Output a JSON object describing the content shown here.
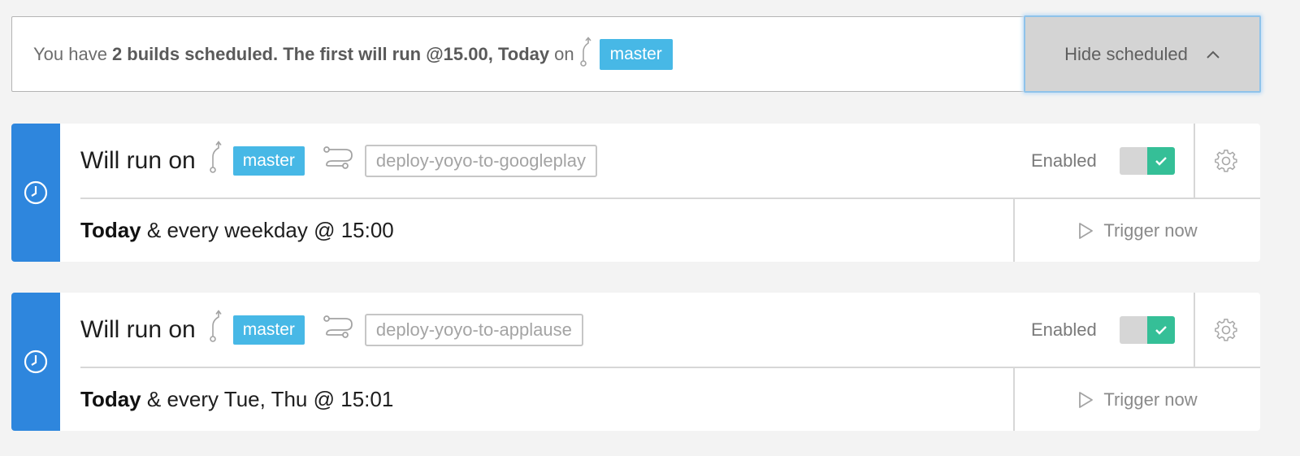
{
  "banner": {
    "prefix": "You have",
    "count_text": "2 builds scheduled. The first will run @15.00, Today",
    "suffix": "on",
    "branch": "master",
    "hide_button_label": "Hide scheduled"
  },
  "schedules": [
    {
      "will_run_label": "Will run on",
      "branch": "master",
      "workflow": "deploy-yoyo-to-googleplay",
      "enabled_label": "Enabled",
      "enabled": true,
      "day": "Today",
      "recurrence": "& every weekday @ 15:00",
      "trigger_label": "Trigger now"
    },
    {
      "will_run_label": "Will run on",
      "branch": "master",
      "workflow": "deploy-yoyo-to-applause",
      "enabled_label": "Enabled",
      "enabled": true,
      "day": "Today",
      "recurrence": "& every Tue, Thu @ 15:01",
      "trigger_label": "Trigger now"
    }
  ],
  "colors": {
    "accent_blue": "#2e86dd",
    "branch_badge": "#47b8e6",
    "toggle_on": "#35bf97"
  },
  "icons": {
    "clock": "clock-icon",
    "branch": "git-branch-icon",
    "workflow": "workflow-icon",
    "gear": "gear-icon",
    "play": "play-icon",
    "check": "check-icon",
    "chevron": "chevron-up-icon"
  }
}
